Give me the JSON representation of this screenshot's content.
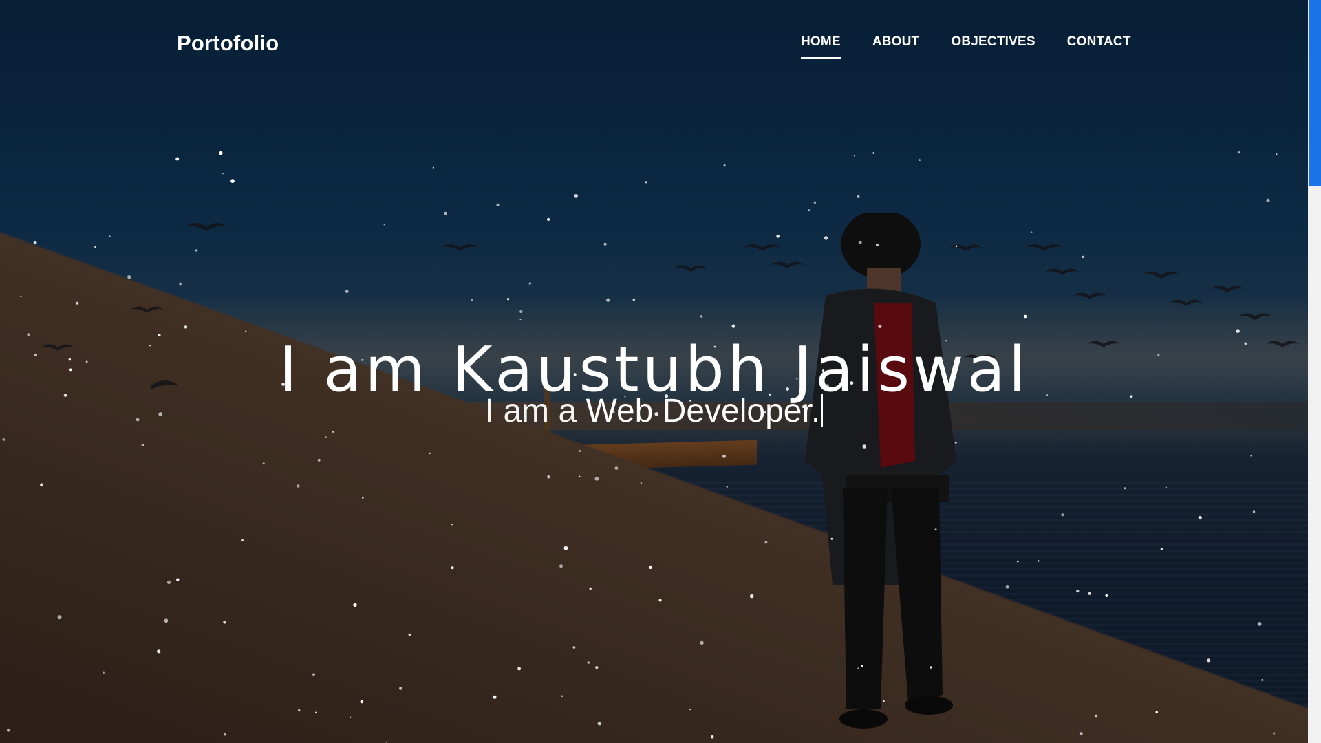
{
  "header": {
    "logo": "Portofolio",
    "nav": [
      {
        "label": "HOME",
        "active": true
      },
      {
        "label": "ABOUT",
        "active": false
      },
      {
        "label": "OBJECTIVES",
        "active": false
      },
      {
        "label": "CONTACT",
        "active": false
      }
    ]
  },
  "hero": {
    "headline": "I am Kaustubh Jaiswal",
    "subline_lead": "I am a ",
    "subline_role": "Web Developer."
  },
  "colors": {
    "text": "#ffffff",
    "scroll_thumb": "#1a73e8"
  }
}
